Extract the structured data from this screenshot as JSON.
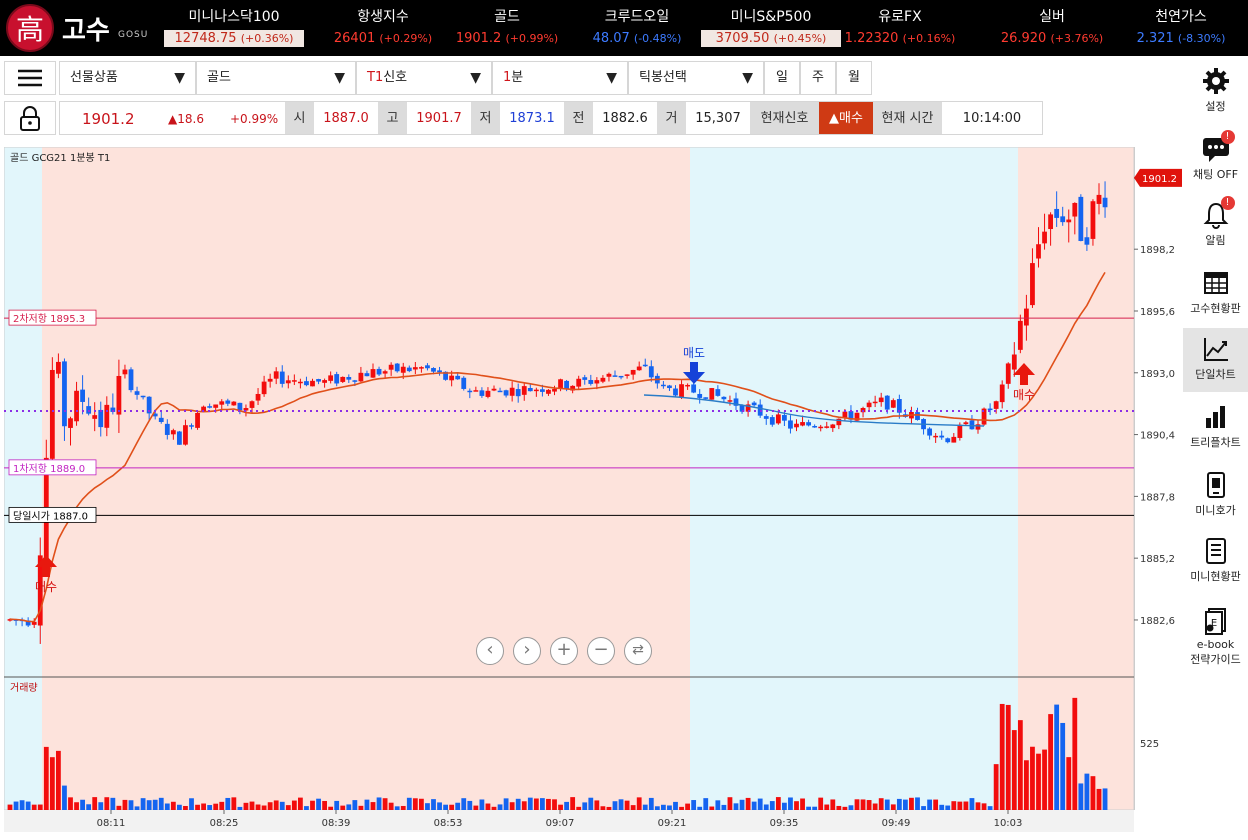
{
  "app": {
    "logo_char": "高",
    "logo_name": "고수",
    "logo_sub": "GOSU"
  },
  "tickers": [
    {
      "name": "미니나스닥100",
      "price": "12748.75",
      "chg": "(+0.36%)",
      "style": "box"
    },
    {
      "name": "항생지수",
      "price": "26401",
      "chg": "(+0.29%)",
      "style": "up"
    },
    {
      "name": "골드",
      "price": "1901.2",
      "chg": "(+0.99%)",
      "style": "up"
    },
    {
      "name": "크루드오일",
      "price": "48.07",
      "chg": "(-0.48%)",
      "style": "dn"
    },
    {
      "name": "미니S&P500",
      "price": "3709.50",
      "chg": "(+0.45%)",
      "style": "box"
    },
    {
      "name": "유로FX",
      "price": "1.22320",
      "chg": "(+0.16%)",
      "style": "up"
    },
    {
      "name": "실버",
      "price": "26.920",
      "chg": "(+3.76%)",
      "style": "up"
    },
    {
      "name": "천연가스",
      "price": "2.321",
      "chg": "(-8.30%)",
      "style": "dn"
    }
  ],
  "toolbar": {
    "product_select": "선물상품",
    "item_select": "골드",
    "signal_prefix": "T1",
    "signal_select": "신호",
    "interval_num": "1",
    "interval_unit": "분",
    "tick_select": "틱봉선택",
    "period_day": "일",
    "period_week": "주",
    "period_month": "월"
  },
  "quote": {
    "price": "1901.2",
    "change": "▲18.6",
    "change_pct": "+0.99%",
    "open_label": "시",
    "open": "1887.0",
    "high_label": "고",
    "high": "1901.7",
    "low_label": "저",
    "low": "1873.1",
    "prev_label": "전",
    "prev": "1882.6",
    "vol_label": "거",
    "volume": "15,307",
    "signal_label": "현재신호",
    "signal_value": "▲매수",
    "time_label": "현재 시간",
    "time_value": "10:14:00"
  },
  "chart_data": {
    "type": "candlestick",
    "title": "골드 GCG21 1분봉 T1",
    "ylim": [
      1880.2,
      1902.5
    ],
    "y_ticks": [
      "1898,2",
      "1895,6",
      "1893,0",
      "1890,4",
      "1887,8",
      "1885,2",
      "1882,6"
    ],
    "x_ticks": [
      "08:11",
      "08:25",
      "08:39",
      "08:53",
      "09:07",
      "09:21",
      "09:35",
      "09:49",
      "10:03"
    ],
    "current_price_label": "1901.2",
    "levels": [
      {
        "label": "2차저항 1895.3",
        "value": 1895.3,
        "color": "#d6204e"
      },
      {
        "label": "1차저항 1889.0",
        "value": 1889.0,
        "color": "#c224c2"
      },
      {
        "label": "당일시가 1887.0",
        "value": 1887.0,
        "color": "#000000"
      }
    ],
    "signals": [
      {
        "label": "매수",
        "type": "buy"
      },
      {
        "label": "매도",
        "type": "sell"
      },
      {
        "label": "매수",
        "type": "buy"
      }
    ],
    "volume_label": "거래량",
    "volume_tick": "525",
    "colors": {
      "up": "#f20d0d",
      "down": "#1464f0",
      "buy_zone": "#fde3dc",
      "sell_zone": "#e2f6fb",
      "ma": "#e0501a"
    }
  },
  "sidebar": [
    {
      "label": "설정",
      "icon": "gear-icon"
    },
    {
      "label": "채팅 OFF",
      "icon": "chat-icon"
    },
    {
      "label": "알림",
      "icon": "bell-icon"
    },
    {
      "label": "고수현황판",
      "icon": "table-icon"
    },
    {
      "label": "단일차트",
      "icon": "line-chart-icon"
    },
    {
      "label": "트리플차트",
      "icon": "bar-chart-icon"
    },
    {
      "label": "미니호가",
      "icon": "phone-icon"
    },
    {
      "label": "미니현황판",
      "icon": "list-icon"
    },
    {
      "label": "e-book",
      "label2": "전략가이드",
      "icon": "ebook-icon"
    }
  ],
  "badge_text": "!"
}
